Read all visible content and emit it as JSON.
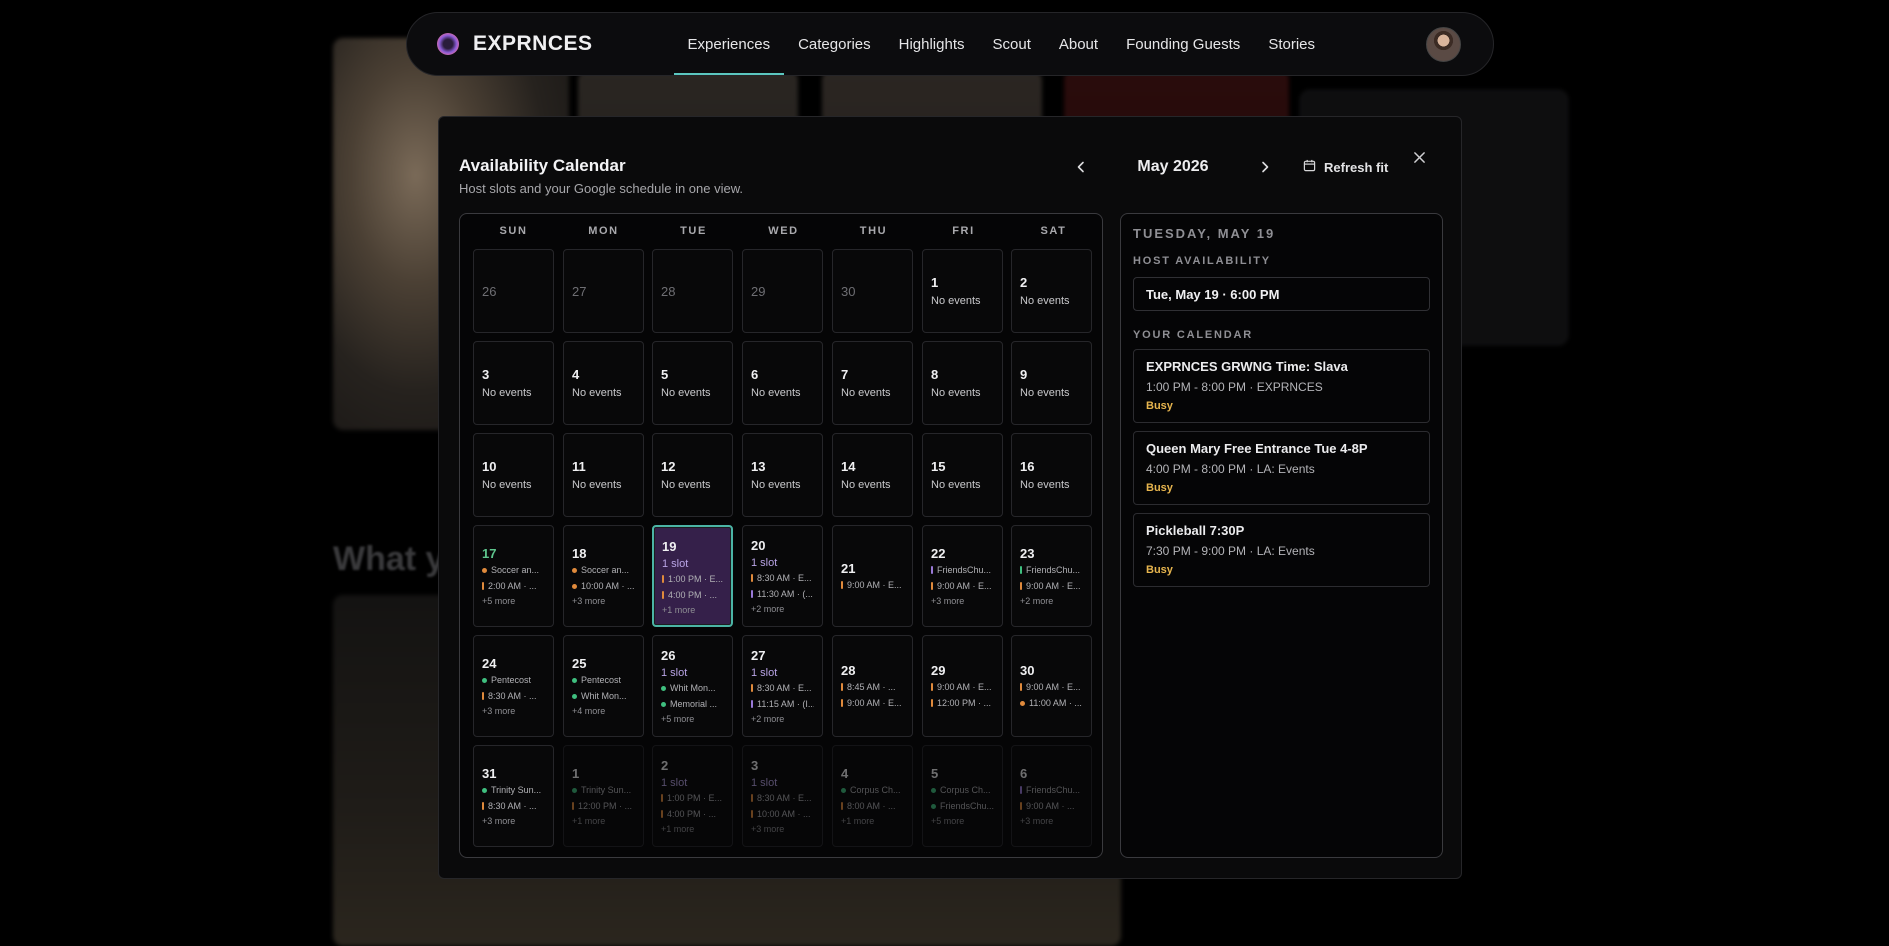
{
  "nav": {
    "brand": "EXPRNCES",
    "links": [
      "Experiences",
      "Categories",
      "Highlights",
      "Scout",
      "About",
      "Founding Guests",
      "Stories"
    ],
    "active_index": 0
  },
  "background": {
    "heading": "What y"
  },
  "modal": {
    "title": "Availability Calendar",
    "subtitle": "Host slots and your Google schedule in one view.",
    "month": "May 2026",
    "refresh_label": "Refresh fit",
    "prev_icon": "chevron-left-icon",
    "next_icon": "chevron-right-icon",
    "close_icon": "close-icon",
    "calendar_icon": "calendar-icon"
  },
  "colors": {
    "accent_teal": "#4bb4a5",
    "selected_bg": "#35204a",
    "slot_text": "#b9a4e6",
    "busy": "#e7b54e",
    "marker_orange": "#e08a3c",
    "marker_green": "#3fbf7f",
    "marker_purple": "#9a7ad8"
  },
  "calendar": {
    "weekdays": [
      "SUN",
      "MON",
      "TUE",
      "WED",
      "THU",
      "FRI",
      "SAT"
    ],
    "weeks": [
      [
        {
          "day": "26",
          "faint": true
        },
        {
          "day": "27",
          "faint": true
        },
        {
          "day": "28",
          "faint": true
        },
        {
          "day": "29",
          "faint": true
        },
        {
          "day": "30",
          "faint": true
        },
        {
          "day": "1",
          "no_events": "No events"
        },
        {
          "day": "2",
          "no_events": "No events"
        }
      ],
      [
        {
          "day": "3",
          "no_events": "No events"
        },
        {
          "day": "4",
          "no_events": "No events"
        },
        {
          "day": "5",
          "no_events": "No events"
        },
        {
          "day": "6",
          "no_events": "No events"
        },
        {
          "day": "7",
          "no_events": "No events"
        },
        {
          "day": "8",
          "no_events": "No events"
        },
        {
          "day": "9",
          "no_events": "No events"
        }
      ],
      [
        {
          "day": "10",
          "no_events": "No events"
        },
        {
          "day": "11",
          "no_events": "No events"
        },
        {
          "day": "12",
          "no_events": "No events"
        },
        {
          "day": "13",
          "no_events": "No events"
        },
        {
          "day": "14",
          "no_events": "No events"
        },
        {
          "day": "15",
          "no_events": "No events"
        },
        {
          "day": "16",
          "no_events": "No events"
        }
      ],
      [
        {
          "day": "17",
          "today": true,
          "events": [
            {
              "text": "Soccer an...",
              "kind": "dot-orange"
            },
            {
              "text": "2:00 AM · ...",
              "kind": "bar-orange"
            }
          ],
          "more": "+5 more"
        },
        {
          "day": "18",
          "events": [
            {
              "text": "Soccer an...",
              "kind": "dot-orange"
            },
            {
              "text": "10:00 AM · ...",
              "kind": "dot-orange"
            }
          ],
          "more": "+3 more"
        },
        {
          "day": "19",
          "selected": true,
          "slot": "1 slot",
          "events": [
            {
              "text": "1:00 PM · E...",
              "kind": "bar-orange"
            },
            {
              "text": "4:00 PM · ...",
              "kind": "bar-orange"
            }
          ],
          "more": "+1 more"
        },
        {
          "day": "20",
          "slot": "1 slot",
          "events": [
            {
              "text": "8:30 AM · E...",
              "kind": "bar-orange"
            },
            {
              "text": "11:30 AM · (...",
              "kind": "bar-purple"
            }
          ],
          "more": "+2 more"
        },
        {
          "day": "21",
          "events": [
            {
              "text": "9:00 AM · E...",
              "kind": "bar-orange"
            }
          ]
        },
        {
          "day": "22",
          "events": [
            {
              "text": "FriendsChu...",
              "kind": "bar-purple"
            },
            {
              "text": "9:00 AM · E...",
              "kind": "bar-orange"
            }
          ],
          "more": "+3 more"
        },
        {
          "day": "23",
          "events": [
            {
              "text": "FriendsChu...",
              "kind": "bar-green"
            },
            {
              "text": "9:00 AM · E...",
              "kind": "bar-orange"
            }
          ],
          "more": "+2 more"
        }
      ],
      [
        {
          "day": "24",
          "events": [
            {
              "text": "Pentecost",
              "kind": "dot-green"
            },
            {
              "text": "8:30 AM · ...",
              "kind": "bar-orange"
            }
          ],
          "more": "+3 more"
        },
        {
          "day": "25",
          "events": [
            {
              "text": "Pentecost",
              "kind": "dot-green"
            },
            {
              "text": "Whit Mon...",
              "kind": "dot-green"
            }
          ],
          "more": "+4 more"
        },
        {
          "day": "26",
          "slot": "1 slot",
          "events": [
            {
              "text": "Whit Mon...",
              "kind": "dot-green"
            },
            {
              "text": "Memorial ...",
              "kind": "dot-green"
            }
          ],
          "more": "+5 more"
        },
        {
          "day": "27",
          "slot": "1 slot",
          "events": [
            {
              "text": "8:30 AM · E...",
              "kind": "bar-orange"
            },
            {
              "text": "11:15 AM · (I...",
              "kind": "bar-purple"
            }
          ],
          "more": "+2 more"
        },
        {
          "day": "28",
          "events": [
            {
              "text": "8:45 AM · ...",
              "kind": "bar-orange"
            },
            {
              "text": "9:00 AM · E...",
              "kind": "bar-orange"
            }
          ]
        },
        {
          "day": "29",
          "events": [
            {
              "text": "9:00 AM · E...",
              "kind": "bar-orange"
            },
            {
              "text": "12:00 PM · ...",
              "kind": "bar-orange"
            }
          ]
        },
        {
          "day": "30",
          "events": [
            {
              "text": "9:00 AM · E...",
              "kind": "bar-orange"
            },
            {
              "text": "11:00 AM · ...",
              "kind": "dot-orange"
            }
          ]
        }
      ],
      [
        {
          "day": "31",
          "events": [
            {
              "text": "Trinity Sun...",
              "kind": "dot-green"
            },
            {
              "text": "8:30 AM · ...",
              "kind": "bar-orange"
            }
          ],
          "more": "+3 more"
        },
        {
          "day": "1",
          "dim": true,
          "events": [
            {
              "text": "Trinity Sun...",
              "kind": "dot-green"
            },
            {
              "text": "12:00 PM · ...",
              "kind": "bar-orange"
            }
          ],
          "more": "+1 more"
        },
        {
          "day": "2",
          "dim": true,
          "slot": "1 slot",
          "events": [
            {
              "text": "1:00 PM · E...",
              "kind": "bar-orange"
            },
            {
              "text": "4:00 PM · ...",
              "kind": "bar-orange"
            }
          ],
          "more": "+1 more"
        },
        {
          "day": "3",
          "dim": true,
          "slot": "1 slot",
          "events": [
            {
              "text": "8:30 AM · E...",
              "kind": "bar-orange"
            },
            {
              "text": "10:00 AM · ...",
              "kind": "bar-orange"
            }
          ],
          "more": "+3 more"
        },
        {
          "day": "4",
          "dim": true,
          "events": [
            {
              "text": "Corpus Ch...",
              "kind": "dot-green"
            },
            {
              "text": "8:00 AM · ...",
              "kind": "bar-orange"
            }
          ],
          "more": "+1 more"
        },
        {
          "day": "5",
          "dim": true,
          "events": [
            {
              "text": "Corpus Ch...",
              "kind": "dot-green"
            },
            {
              "text": "FriendsChu...",
              "kind": "dot-green"
            }
          ],
          "more": "+5 more"
        },
        {
          "day": "6",
          "dim": true,
          "events": [
            {
              "text": "FriendsChu...",
              "kind": "bar-purple"
            },
            {
              "text": "9:00 AM · ...",
              "kind": "bar-orange"
            }
          ],
          "more": "+3 more"
        }
      ]
    ]
  },
  "side": {
    "date_heading": "TUESDAY, MAY 19",
    "host_label": "HOST AVAILABILITY",
    "host_slot": "Tue, May 19 · 6:00 PM",
    "calendar_label": "YOUR CALENDAR",
    "events": [
      {
        "title": "EXPRNCES GRWNG Time: Slava",
        "time": "1:00 PM - 8:00 PM · EXPRNCES",
        "status": "Busy"
      },
      {
        "title": "Queen Mary Free Entrance Tue 4-8P",
        "time": "4:00 PM - 8:00 PM · LA: Events",
        "status": "Busy"
      },
      {
        "title": "Pickleball 7:30P",
        "time": "7:30 PM - 9:00 PM · LA: Events",
        "status": "Busy"
      }
    ]
  }
}
